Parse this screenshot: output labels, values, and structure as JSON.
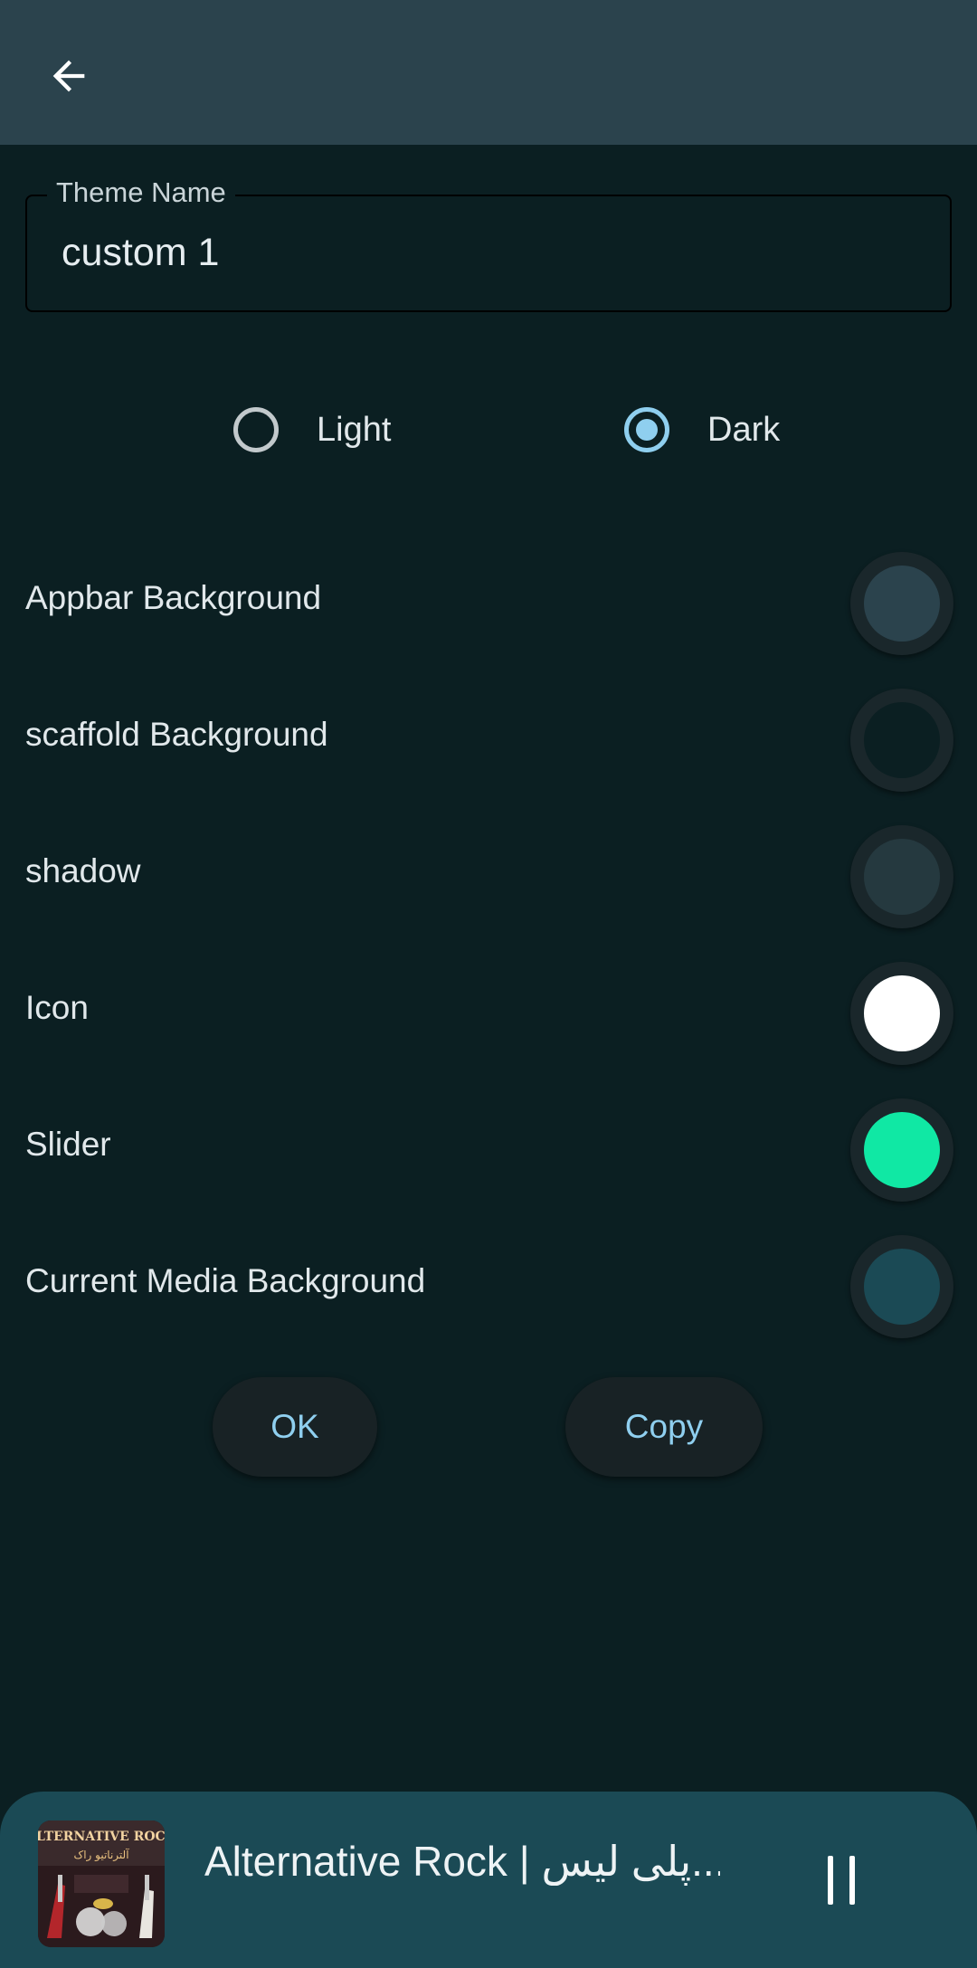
{
  "appbar": {
    "back_icon": "arrow-left-icon"
  },
  "theme_name": {
    "label": "Theme Name",
    "value": "custom 1"
  },
  "mode": {
    "options": [
      {
        "label": "Light",
        "selected": false
      },
      {
        "label": "Dark",
        "selected": true
      }
    ]
  },
  "colors": [
    {
      "label": "Appbar Background",
      "color": "#2b434d"
    },
    {
      "label": "scaffold Background",
      "color": "#0b1f22"
    },
    {
      "label": "shadow",
      "color": "#25393f"
    },
    {
      "label": "Icon",
      "color": "#ffffff"
    },
    {
      "label": "Slider",
      "color": "#10e8a4"
    },
    {
      "label": "Current Media Background",
      "color": "#1b4a55"
    }
  ],
  "actions": {
    "ok_label": "OK",
    "copy_label": "Copy"
  },
  "player": {
    "title": "Alternative Rock | پلی لیس...",
    "cover_text": "ALTERNATIVE ROCK",
    "cover_subtext": "آلترناتیو راک",
    "pause_icon": "pause-icon"
  }
}
